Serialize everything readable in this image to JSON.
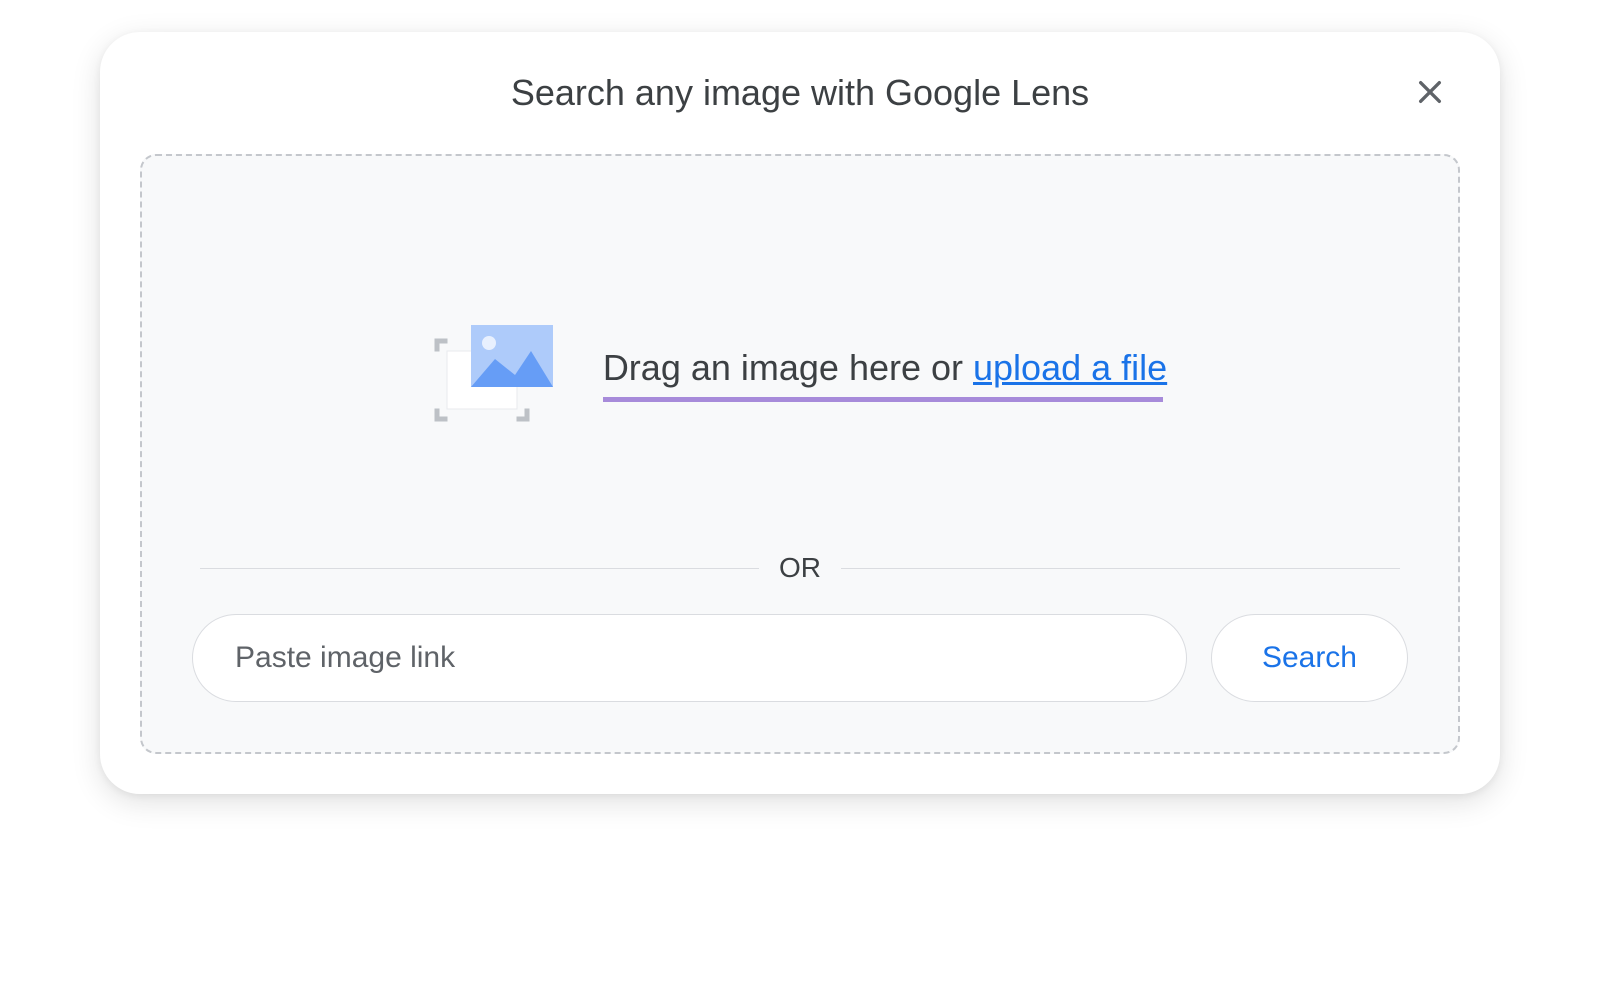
{
  "dialog": {
    "title": "Search any image with Google Lens",
    "drag_text": "Drag an image here or ",
    "upload_link_text": "upload a file",
    "divider_text": "OR",
    "input_placeholder": "Paste image link",
    "search_button_label": "Search"
  }
}
